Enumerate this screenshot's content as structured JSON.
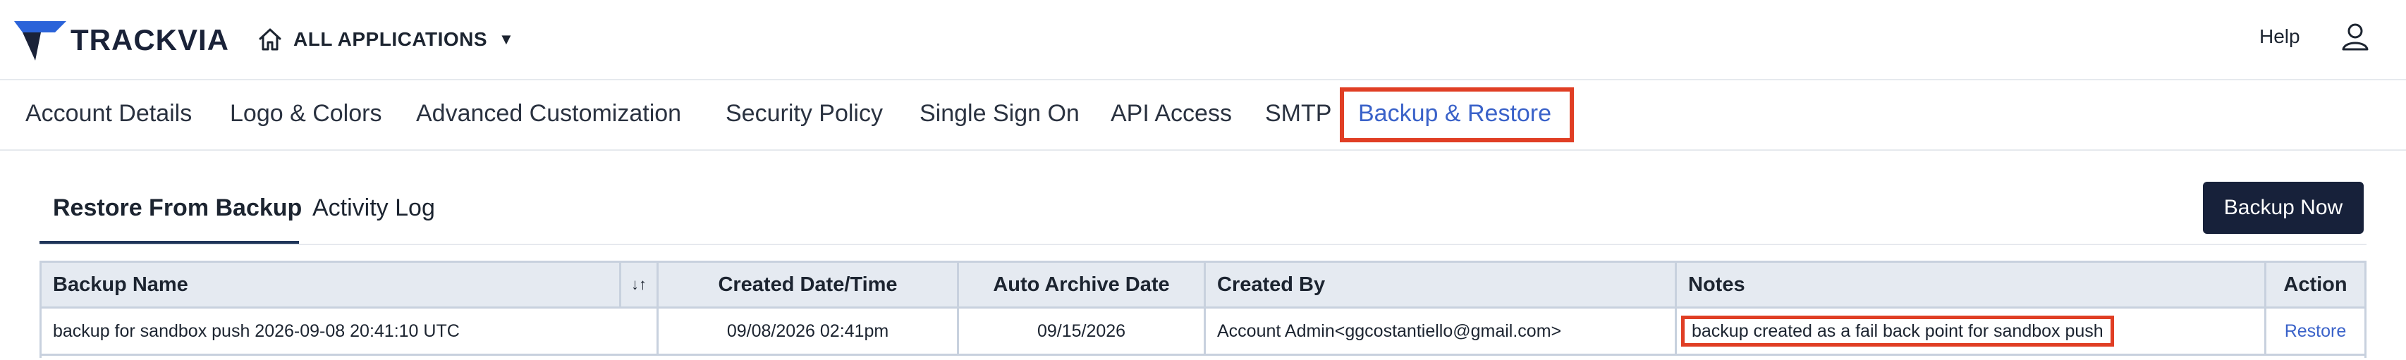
{
  "brand": {
    "name": "TRACKVIA"
  },
  "header": {
    "apps_label": "ALL APPLICATIONS",
    "help": "Help"
  },
  "nav_tabs": [
    {
      "label": "Account Details"
    },
    {
      "label": "Logo & Colors"
    },
    {
      "label": "Advanced Customization"
    },
    {
      "label": "Security Policy"
    },
    {
      "label": "Single Sign On"
    },
    {
      "label": "API Access"
    },
    {
      "label": "SMTP"
    },
    {
      "label": "Backup & Restore",
      "active": true
    }
  ],
  "sub_tabs": [
    {
      "label": "Restore From Backup",
      "active": true
    },
    {
      "label": "Activity Log"
    }
  ],
  "backup_button": "Backup Now",
  "table": {
    "columns": [
      "Backup Name",
      "Created Date/Time",
      "Auto Archive Date",
      "Created By",
      "Notes",
      "Action"
    ],
    "rows": [
      {
        "name": "backup for sandbox push 2026-09-08 20:41:10 UTC",
        "created": "09/08/2026 02:41pm",
        "archive": "09/15/2026",
        "created_by": "Account Admin<ggcostantiello@gmail.com>",
        "notes": "backup created as a fail back point for sandbox push",
        "action": "Restore"
      }
    ]
  },
  "colors": {
    "accent": "#3a62c9",
    "highlight": "#e03e24",
    "button_bg": "#17213a",
    "header_bg": "#e5eaf1"
  }
}
